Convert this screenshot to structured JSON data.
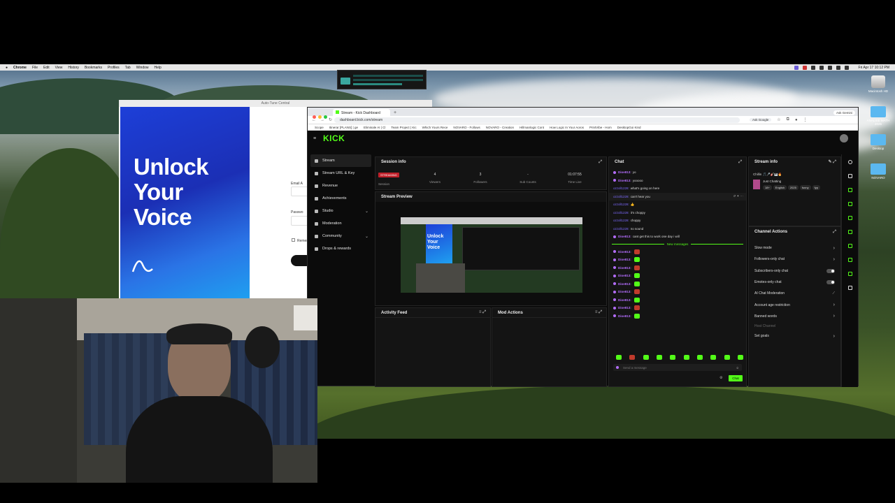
{
  "menubar": {
    "items": [
      "Chrome",
      "File",
      "Edit",
      "View",
      "History",
      "Bookmarks",
      "Profiles",
      "Tab",
      "Window",
      "Help"
    ],
    "clock": "Fri Apr 17  10:12 PM"
  },
  "desktop_icons": [
    {
      "label": "Macintosh HD",
      "kind": "drive"
    },
    {
      "label": "ANALISE MATH 2025",
      "kind": "folder"
    },
    {
      "label": "Desktop",
      "kind": "folder"
    },
    {
      "label": "NOVARO",
      "kind": "folder"
    }
  ],
  "autotune": {
    "title": "Auto-Tune Central",
    "headline": [
      "Unlock",
      "Your",
      "Voice"
    ],
    "email_label": "Email A",
    "password_label": "Passwo",
    "remember_label": "Remem"
  },
  "browser": {
    "tab_title": "Stream - Kick Dashboard",
    "url": "dashboard.kick.com/stream",
    "ask_google": "Ask Google",
    "ask_gemini": "Ask Gemini",
    "bookmarks": [
      "Scope",
      "Itinerar [PLANS] | ge",
      "Eliminale AI | Cl",
      "Team Project | Kic",
      "Which Yours Rece",
      "NOVARO - Follows",
      "NOVARO - Creation",
      "Hillmanlogic Cont",
      "How Logic In Your Aoros",
      "PrintVibe - Hom",
      "DesktopGoi Kind"
    ]
  },
  "kick": {
    "logo": "KICK",
    "sidebar": [
      {
        "label": "Stream",
        "icon": "stream-icon",
        "active": true,
        "chevron": false
      },
      {
        "label": "Stream URL & Key",
        "icon": "key-icon",
        "active": false,
        "chevron": false
      },
      {
        "label": "Revenue",
        "icon": "revenue-icon",
        "active": false,
        "chevron": false
      },
      {
        "label": "Achievements",
        "icon": "trophy-icon",
        "active": false,
        "chevron": false
      },
      {
        "label": "Studio",
        "icon": "studio-icon",
        "active": false,
        "chevron": true
      },
      {
        "label": "Moderation",
        "icon": "shield-icon",
        "active": false,
        "chevron": false
      },
      {
        "label": "Community",
        "icon": "community-icon",
        "active": false,
        "chevron": true
      },
      {
        "label": "Drops & rewards",
        "icon": "gift-icon",
        "active": false,
        "chevron": false
      }
    ],
    "session": {
      "title": "Session info",
      "status": "STREAMING",
      "stats": [
        {
          "label": "Session",
          "value": ""
        },
        {
          "label": "Viewers",
          "value": "4"
        },
        {
          "label": "Followers",
          "value": "3"
        },
        {
          "label": "Sub Counts",
          "value": "-"
        },
        {
          "label": "Time Live",
          "value": "01:07:55"
        }
      ]
    },
    "preview": {
      "title": "Stream Preview",
      "headline": [
        "Unlock",
        "Your",
        "Voice"
      ]
    },
    "activity": {
      "title": "Activity Feed"
    },
    "mod_actions": {
      "title": "Mod Actions"
    },
    "chat": {
      "title": "Chat",
      "messages": [
        {
          "user": "Dioe813:",
          "text": "yo",
          "badge": true
        },
        {
          "user": "Dioe813:",
          "text": "yooooo",
          "badge": true
        },
        {
          "user": "ozzoll1228:",
          "text": "what's going on here",
          "badge": false
        },
        {
          "user": "ozzoll1228:",
          "text": "can't hear you",
          "badge": false
        },
        {
          "user": "ozzoll1228:",
          "text": "👍",
          "badge": false
        },
        {
          "user": "ozzoll1228:",
          "text": "it's choppy",
          "badge": false
        },
        {
          "user": "ozzoll1228:",
          "text": "choppy",
          "badge": false
        },
        {
          "user": "ozzoll1228:",
          "text": "no sound",
          "badge": false
        },
        {
          "user": "Dioe813:",
          "text": "cant get this to work one day i will",
          "badge": true
        }
      ],
      "new_messages": "New messages",
      "emote_lines": [
        {
          "user": "Dioe813:",
          "emote": "red"
        },
        {
          "user": "Dioe813:",
          "emote": "green"
        },
        {
          "user": "Dioe813:",
          "emote": "red"
        },
        {
          "user": "Dioe813:",
          "emote": "green"
        },
        {
          "user": "Dioe813:",
          "emote": "green"
        },
        {
          "user": "Dioe813:",
          "emote": "red"
        },
        {
          "user": "Dioe813:",
          "emote": "green"
        },
        {
          "user": "Dioe813:",
          "emote": "red"
        },
        {
          "user": "Dioe813:",
          "emote": "green"
        }
      ],
      "input_placeholder": "Send a message",
      "send_label": "Chat"
    },
    "stream_info": {
      "title": "Stream info",
      "stream_title": "Chillin 🎵🎤🎸🎹🔥",
      "category": "Just Chatting",
      "tags": [
        "18+",
        "English",
        "2025",
        "funny",
        "fyp"
      ]
    },
    "channel_actions": {
      "title": "Channel Actions",
      "items": [
        {
          "label": "Slow mode",
          "type": "chevron"
        },
        {
          "label": "Followers-only chat",
          "type": "chevron"
        },
        {
          "label": "Subscribers-only chat",
          "type": "toggle"
        },
        {
          "label": "Emotes-only chat",
          "type": "toggle"
        },
        {
          "label": "AI Chat Moderation",
          "type": "chart"
        },
        {
          "label": "Account age restriction",
          "type": "chevron"
        },
        {
          "label": "Banned words",
          "type": "chevron"
        },
        {
          "label": "Host Channel",
          "type": "none"
        },
        {
          "label": "Set goals",
          "type": "chevron"
        }
      ]
    }
  }
}
